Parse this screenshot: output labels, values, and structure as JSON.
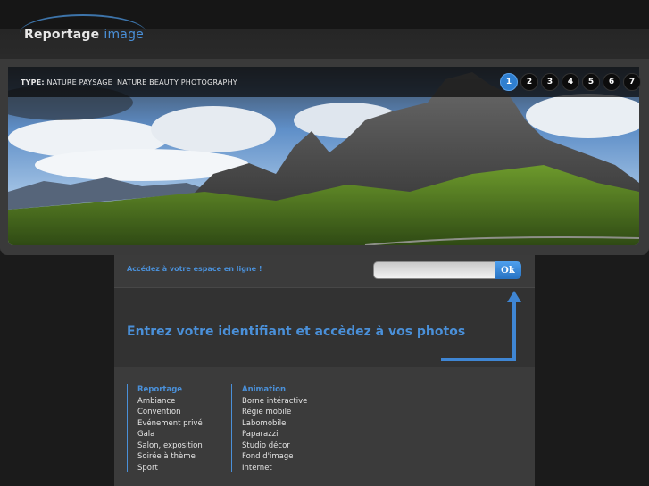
{
  "header": {
    "logo_word1": "Reportage",
    "logo_word2": "image",
    "accent_color": "#4a90d9"
  },
  "banner": {
    "type_label": "TYPE:",
    "type_value": "NATURE PAYSAGE",
    "title": "NATURE BEAUTY PHOTOGRAPHY",
    "pages": [
      "1",
      "2",
      "3",
      "4",
      "5",
      "6",
      "7"
    ],
    "active_page": "1"
  },
  "login": {
    "label": "Accédez à votre espace en ligne !",
    "input_value": "",
    "input_placeholder": "",
    "button_label": "Ok"
  },
  "hero": {
    "text": "Entrez votre identifiant et accèdez à vos photos"
  },
  "links": {
    "reportage": {
      "heading": "Reportage",
      "items": [
        "Ambiance",
        "Convention",
        "Evénement privé",
        "Gala",
        "Salon, exposition",
        "Soirée à thème",
        "Sport"
      ]
    },
    "animation": {
      "heading": "Animation",
      "items": [
        "Borne intéractive",
        "Régie mobile",
        "Labomobile",
        "Paparazzi",
        "Studio décor",
        "Fond d'image",
        "Internet"
      ]
    }
  }
}
